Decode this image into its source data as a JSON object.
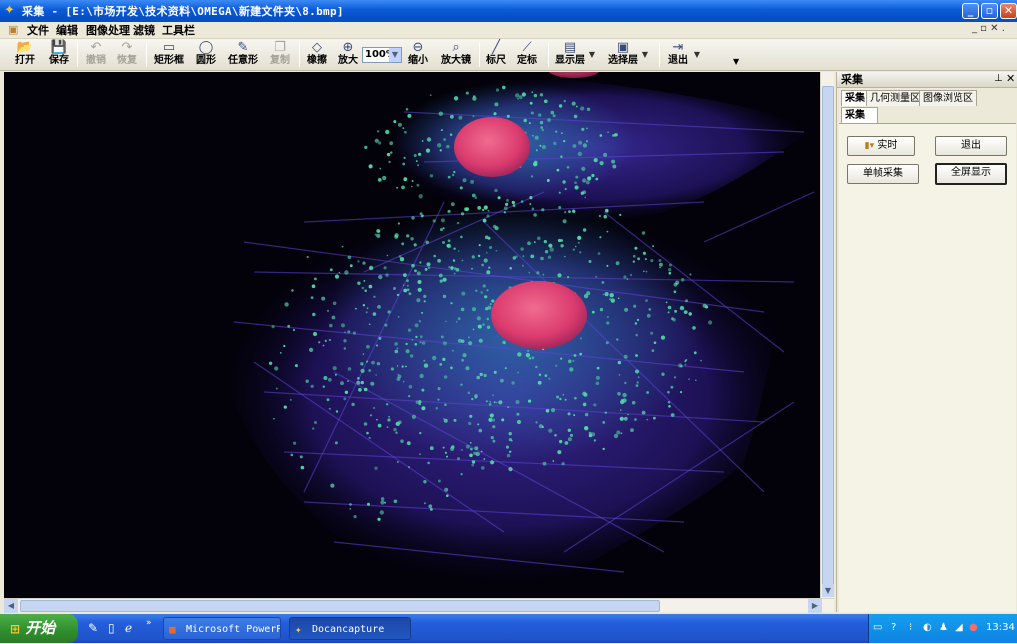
{
  "window": {
    "title": "采集 - [E:\\市场开发\\技术资料\\OMEGA\\新建文件夹\\8.bmp]",
    "min_glyph": "_",
    "max_glyph": "▫",
    "close_glyph": "✕"
  },
  "menu": {
    "items": [
      "文件",
      "编辑",
      "图像处理",
      "滤镜",
      "工具栏"
    ],
    "mdi_buttons": "_ ▫ ✕ ."
  },
  "toolbar": {
    "open": "打开",
    "save": "保存",
    "undo": "撤销",
    "redo": "恢复",
    "rect": "矩形框",
    "circle": "圆形",
    "freeform": "任意形",
    "copy": "复制",
    "eraser": "橡擦",
    "zoom_in": "放大",
    "zoom_value": "100%",
    "zoom_out": "缩小",
    "magnifier": "放大镜",
    "ruler": "标尺",
    "calibrate": "定标",
    "show_layer": "显示层",
    "select_layer": "选择层",
    "exit": "退出"
  },
  "panel": {
    "title": "采集",
    "tabs": [
      "采集",
      "几何测量区",
      "图像浏览区"
    ],
    "subtab": "采集",
    "buttons": {
      "realtime": "实时",
      "exit": "退出",
      "single_frame": "单帧采集",
      "fullscreen": "全屏显示"
    }
  },
  "taskbar": {
    "start": "开始",
    "tasks": [
      "Microsoft PowerP...",
      "Docancapture"
    ],
    "clock": "13:34"
  },
  "colors": {
    "titlebar": "#0A5AD8",
    "taskbar": "#245EDC",
    "start_button": "#2F8E2C",
    "image_background": "#03020B",
    "nucleus": "#E0386E",
    "actin": "#4B2FB8",
    "vesicles": "#52D9A8"
  }
}
